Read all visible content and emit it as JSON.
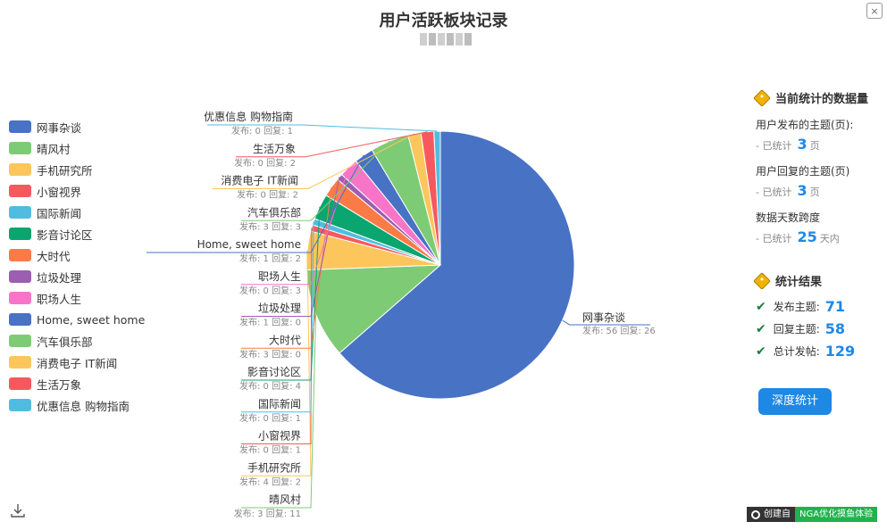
{
  "header": {
    "title": "用户活跃板块记录",
    "close_label": "×"
  },
  "panel": {
    "section1_title": "当前统计的数据量",
    "posted_label": "用户发布的主题(页):",
    "posted_prefix": "- 已统计",
    "posted_value": "3",
    "posted_unit": "页",
    "replied_label": "用户回复的主题(页)",
    "replied_prefix": "- 已统计",
    "replied_value": "3",
    "replied_unit": "页",
    "days_label": "数据天数跨度",
    "days_prefix": "- 已统计",
    "days_value": "25",
    "days_unit": "天内",
    "section2_title": "统计结果",
    "res_post_label": "发布主题:",
    "res_post_value": "71",
    "res_reply_label": "回复主题:",
    "res_reply_value": "58",
    "res_total_label": "总计发帖:",
    "res_total_value": "129",
    "deep_button": "深度统计"
  },
  "credit": {
    "left": "创建自",
    "right": "NGA优化摸鱼体验"
  },
  "colors": [
    "#4872c4",
    "#7ecb76",
    "#fcc65c",
    "#f6595d",
    "#50bde0",
    "#0ba56f",
    "#fb7b46",
    "#9c5eb1",
    "#f774c9"
  ],
  "chart_data": {
    "type": "pie",
    "title": "用户活跃板块记录",
    "legend_position": "left",
    "sub_label_format": "发布: {post} 回复: {reply}",
    "series": [
      {
        "name": "网事杂谈",
        "post": 56,
        "reply": 26,
        "value": 82
      },
      {
        "name": "晴风村",
        "post": 3,
        "reply": 11,
        "value": 14
      },
      {
        "name": "手机研究所",
        "post": 4,
        "reply": 2,
        "value": 6
      },
      {
        "name": "小窗视界",
        "post": 0,
        "reply": 1,
        "value": 1
      },
      {
        "name": "国际新闻",
        "post": 0,
        "reply": 1,
        "value": 1
      },
      {
        "name": "影音讨论区",
        "post": 0,
        "reply": 4,
        "value": 4
      },
      {
        "name": "大时代",
        "post": 3,
        "reply": 0,
        "value": 3
      },
      {
        "name": "垃圾处理",
        "post": 1,
        "reply": 0,
        "value": 1
      },
      {
        "name": "职场人生",
        "post": 0,
        "reply": 3,
        "value": 3
      },
      {
        "name": "Home, sweet home",
        "post": 1,
        "reply": 2,
        "value": 3
      },
      {
        "name": "汽车俱乐部",
        "post": 3,
        "reply": 3,
        "value": 6
      },
      {
        "name": "消费电子 IT新闻",
        "post": 0,
        "reply": 2,
        "value": 2
      },
      {
        "name": "生活万象",
        "post": 0,
        "reply": 2,
        "value": 2
      },
      {
        "name": "优惠信息 购物指南",
        "post": 0,
        "reply": 1,
        "value": 1
      }
    ]
  }
}
